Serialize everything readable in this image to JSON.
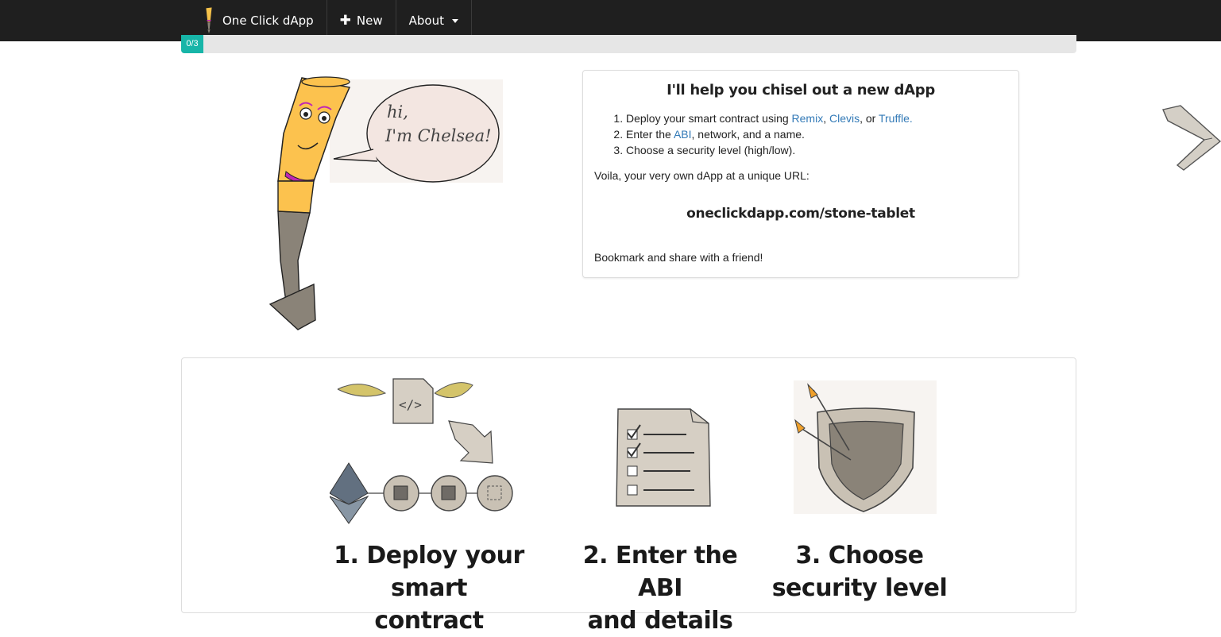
{
  "navbar": {
    "brand": "One Click dApp",
    "new_label": "New",
    "about_label": "About"
  },
  "progress": {
    "label": "0/3",
    "fraction": 0.0
  },
  "chelsea": {
    "line1": "hi,",
    "line2": "I'm Chelsea!"
  },
  "intro": {
    "title": "I'll help you chisel out a new dApp",
    "step1_prefix": "Deploy your smart contract using ",
    "remix": "Remix",
    "sep1": ", ",
    "clevis": "Clevis",
    "sep2": ", or ",
    "truffle": "Truffle.",
    "step2_prefix": "Enter the ",
    "abi": "ABI",
    "step2_suffix": ", network, and a name.",
    "step3": "Choose a security level (high/low).",
    "voila": "Voila, your very own dApp at a unique URL:",
    "url": "oneclickdapp.com/stone-tablet",
    "bookmark": "Bookmark and share with a friend!"
  },
  "steps": [
    {
      "line1": "1. Deploy your smart",
      "line2": "contract"
    },
    {
      "line1": "2. Enter the ABI",
      "line2": "and details"
    },
    {
      "line1": "3. Choose",
      "line2": "security level"
    }
  ],
  "icons": {
    "brand": "pencil-chisel-icon",
    "new": "plus-icon",
    "about": "caret-down-icon",
    "next": "chevron-right-icon"
  }
}
